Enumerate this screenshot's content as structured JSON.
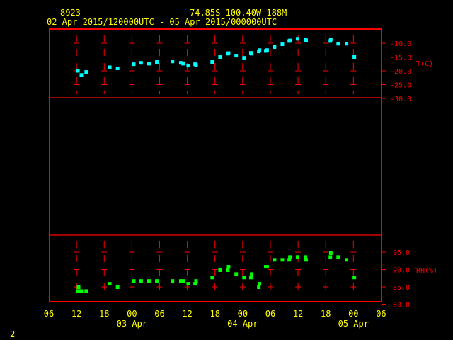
{
  "header": {
    "station": "8923",
    "location": "74.85S  100.40W   188M",
    "period": "02 Apr 2015/120000UTC - 05 Apr 2015/000000UTC"
  },
  "footer_number": "2",
  "colors": {
    "frame": "#ff0000",
    "temp": "#00ffff",
    "rh": "#00ff00",
    "text": "#ffff00"
  },
  "chart_data": [
    {
      "type": "scatter",
      "name": "temperature",
      "ylabel": "T(C)",
      "ylim": [
        -30,
        -7
      ],
      "yticks": [
        "-10.0",
        "-15.0",
        "-20.0",
        "-25.0",
        "-30.0"
      ],
      "x_unit": "hours since 02 Apr 06UTC",
      "x": [
        6.3,
        7.05,
        8.1,
        13.2,
        14.9,
        18.4,
        20,
        21.7,
        23.4,
        26.8,
        28.6,
        29.1,
        30.2,
        31.7,
        31.9,
        35.4,
        37.1,
        38.8,
        38.95,
        40.6,
        42.3,
        43.8,
        43.95,
        45.5,
        45.65,
        47.0,
        47.3,
        48.9,
        50.6,
        52.1,
        52.25,
        53.9,
        55.6,
        55.75,
        61.0,
        61.1,
        62.7,
        64.5,
        66.2
      ],
      "values": [
        -20.0,
        -21.5,
        -20.4,
        -18.7,
        -19.1,
        -17.6,
        -17.1,
        -17.4,
        -16.8,
        -16.6,
        -17.1,
        -17.4,
        -18.1,
        -17.6,
        -17.9,
        -16.8,
        -15.0,
        -13.8,
        -13.6,
        -14.5,
        -15.3,
        -13.5,
        -13.8,
        -13.0,
        -12.5,
        -12.8,
        -12.5,
        -11.4,
        -10.4,
        -9.2,
        -9.0,
        -8.4,
        -8.6,
        -9.0,
        -9.2,
        -8.6,
        -10.2,
        -10.2,
        -15.0
      ]
    },
    {
      "type": "scatter",
      "name": "relative-humidity",
      "ylabel": "RH(%)",
      "ylim": [
        80,
        97
      ],
      "yticks": [
        "95.0",
        "90.0",
        "85.0",
        "80.0"
      ],
      "x_unit": "hours since 02 Apr 06UTC",
      "x": [
        6.3,
        6.45,
        7.05,
        8.1,
        13.2,
        14.9,
        18.4,
        20,
        21.7,
        23.4,
        26.8,
        28.6,
        29.1,
        30.2,
        31.7,
        31.9,
        35.4,
        37.1,
        38.8,
        38.95,
        40.6,
        42.3,
        43.8,
        43.95,
        45.5,
        45.65,
        47.0,
        47.3,
        48.9,
        50.6,
        52.1,
        52.25,
        53.9,
        55.6,
        55.75,
        61.0,
        61.1,
        62.7,
        64.5,
        66.2
      ],
      "values": [
        83.8,
        84.9,
        83.8,
        83.8,
        85.9,
        84.9,
        86.7,
        86.7,
        86.7,
        86.7,
        86.7,
        86.7,
        86.7,
        85.9,
        85.9,
        86.7,
        87.7,
        89.8,
        89.8,
        90.8,
        88.7,
        87.7,
        87.7,
        88.7,
        84.9,
        85.9,
        90.8,
        90.8,
        92.8,
        92.8,
        92.8,
        93.6,
        93.6,
        93.6,
        92.8,
        93.6,
        94.7,
        93.6,
        92.8,
        87.7
      ]
    }
  ],
  "x_axis": {
    "tick_labels": [
      "06",
      "12",
      "18",
      "00",
      "06",
      "12",
      "18",
      "00",
      "06",
      "12",
      "18",
      "00",
      "06"
    ],
    "date_labels": [
      {
        "text": "03 Apr",
        "hour": 18
      },
      {
        "text": "04 Apr",
        "hour": 42
      },
      {
        "text": "05 Apr",
        "hour": 66
      }
    ]
  }
}
